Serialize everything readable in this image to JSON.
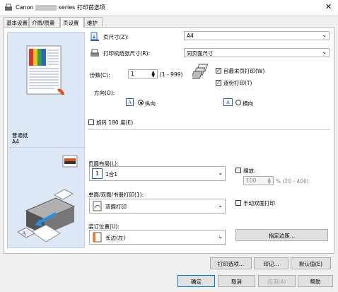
{
  "window": {
    "title_prefix": "Canon",
    "title_suffix": "series 打印首选项",
    "close_glyph": "✕"
  },
  "tabs": [
    {
      "label": "基本设置"
    },
    {
      "label": "介质/质量"
    },
    {
      "label": "页设置"
    },
    {
      "label": "维护"
    }
  ],
  "preview": {
    "media_type": "普通纸",
    "paper_size": "A4"
  },
  "page_size": {
    "label": "页尺寸(Z):",
    "value": "A4"
  },
  "printer_paper_size": {
    "label": "打印机纸张尺寸(R):",
    "value": "同页面尺寸"
  },
  "copies": {
    "label": "份数(C):",
    "value": "1",
    "range": "(1 - 999)"
  },
  "print_from_last_page": {
    "label": "自最末页打印(W)",
    "checked": true
  },
  "collate": {
    "label": "逐份打印(T)",
    "checked": true
  },
  "orientation": {
    "label": "方向(O):",
    "portrait": {
      "label": "纵向",
      "selected": true
    },
    "landscape": {
      "label": "横向",
      "selected": false
    }
  },
  "rotate180": {
    "label": "旋转 180 度(E)",
    "checked": false
  },
  "page_layout": {
    "label": "页面布局(L):",
    "value": "1合1"
  },
  "scaling": {
    "label": "缩放:",
    "value": "100",
    "range": "% (20 - 400)",
    "checked": false
  },
  "duplex": {
    "label": "单面/双面/书册打印(1):",
    "value": "双面打印"
  },
  "manual_duplex": {
    "label": "手动双面打印",
    "checked": false
  },
  "staple_side": {
    "label": "装订位置(U):",
    "value": "长边(左)"
  },
  "specify_margin_button": "指定边距...",
  "buttons": {
    "print_options": "打印选项...",
    "stamp": "印记...",
    "defaults": "默认值(E)",
    "ok": "确定",
    "cancel": "取消",
    "apply": "应用(A)",
    "help": "帮助"
  },
  "colors": {
    "accent": "#0078d7",
    "preview_bg": "#dce8f5",
    "icon_blue": "#2a5fab"
  }
}
